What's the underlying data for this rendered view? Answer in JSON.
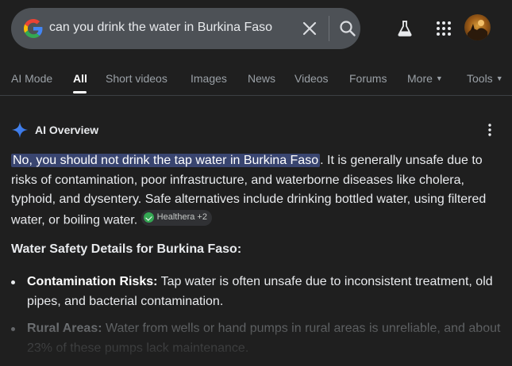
{
  "search": {
    "query": "can you drink the water in Burkina Faso"
  },
  "header": {
    "icons": [
      "google-g-logo",
      "close-icon",
      "search-icon",
      "flask-icon",
      "apps-grid-icon",
      "avatar"
    ]
  },
  "tabs": [
    {
      "label": "AI Mode",
      "active": false
    },
    {
      "label": "All",
      "active": true
    },
    {
      "label": "Short videos",
      "active": false
    },
    {
      "label": "Images",
      "active": false
    },
    {
      "label": "News",
      "active": false
    },
    {
      "label": "Videos",
      "active": false
    },
    {
      "label": "Forums",
      "active": false
    },
    {
      "label": "More",
      "active": false
    },
    {
      "label": "Tools",
      "active": false
    }
  ],
  "ai_overview": {
    "title": "AI Overview",
    "highlight": "No, you should not drink the tap water in Burkina Faso",
    "body": ". It is generally unsafe due to risks of contamination, poor infrastructure, and waterborne diseases like cholera, typhoid, and dysentery. Safe alternatives include drinking bottled water, using filtered water, or boiling water.",
    "source_chip": "Healthera +2",
    "section_heading": "Water Safety Details for Burkina Faso:",
    "bullets": [
      {
        "term": "Contamination Risks:",
        "text": " Tap water is often unsafe due to inconsistent treatment, old pipes, and bacterial contamination."
      },
      {
        "term": "Rural Areas:",
        "text": " Water from wells or hand pumps in rural areas is unreliable, and about 23% of these pumps lack maintenance."
      }
    ]
  },
  "colors": {
    "background": "#1f1f1f",
    "search_bar": "#4d5156",
    "highlight": "#394570",
    "chip": "#303134",
    "gemini_blue": "#4f8df5"
  }
}
